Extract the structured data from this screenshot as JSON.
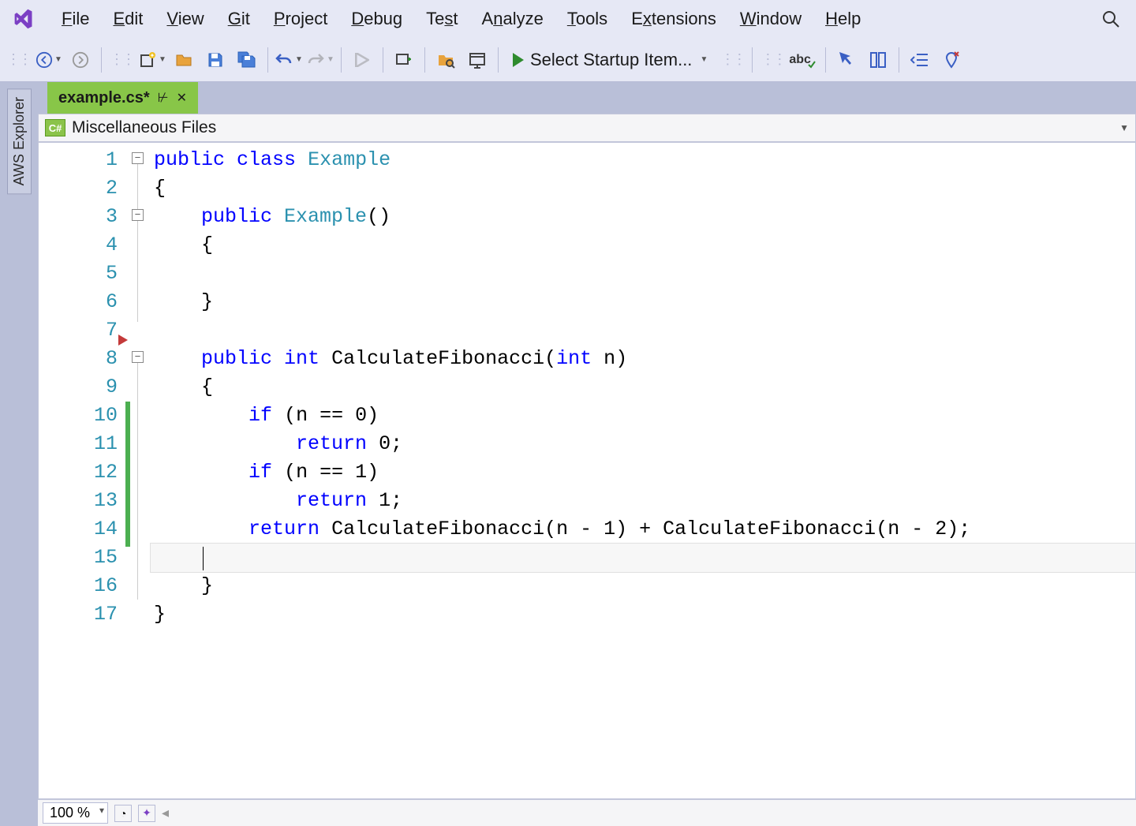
{
  "menu": {
    "file": "File",
    "edit": "Edit",
    "view": "View",
    "git": "Git",
    "project": "Project",
    "debug": "Debug",
    "test": "Test",
    "analyze": "Analyze",
    "tools": "Tools",
    "extensions": "Extensions",
    "window": "Window",
    "help": "Help"
  },
  "toolbar": {
    "startup_label": "Select Startup Item..."
  },
  "sidebar": {
    "aws_explorer": "AWS Explorer"
  },
  "tabs": {
    "active": "example.cs*"
  },
  "context": {
    "scope": "Miscellaneous Files",
    "badge": "C#"
  },
  "editor": {
    "line_count": 17,
    "tokens": {
      "public": "public",
      "class": "class",
      "int": "int",
      "if": "if",
      "return": "return",
      "example_type": "Example",
      "fib_method": "CalculateFibonacci",
      "n": "n"
    },
    "raw_lines": [
      "public class Example",
      "{",
      "    public Example()",
      "    {",
      "",
      "    }",
      "",
      "    public int CalculateFibonacci(int n)",
      "    {",
      "        if (n == 0)",
      "            return 0;",
      "        if (n == 1)",
      "            return 1;",
      "        return CalculateFibonacci(n - 1) + CalculateFibonacci(n - 2);",
      "",
      "    }",
      "}"
    ]
  },
  "status": {
    "zoom": "100 %"
  }
}
